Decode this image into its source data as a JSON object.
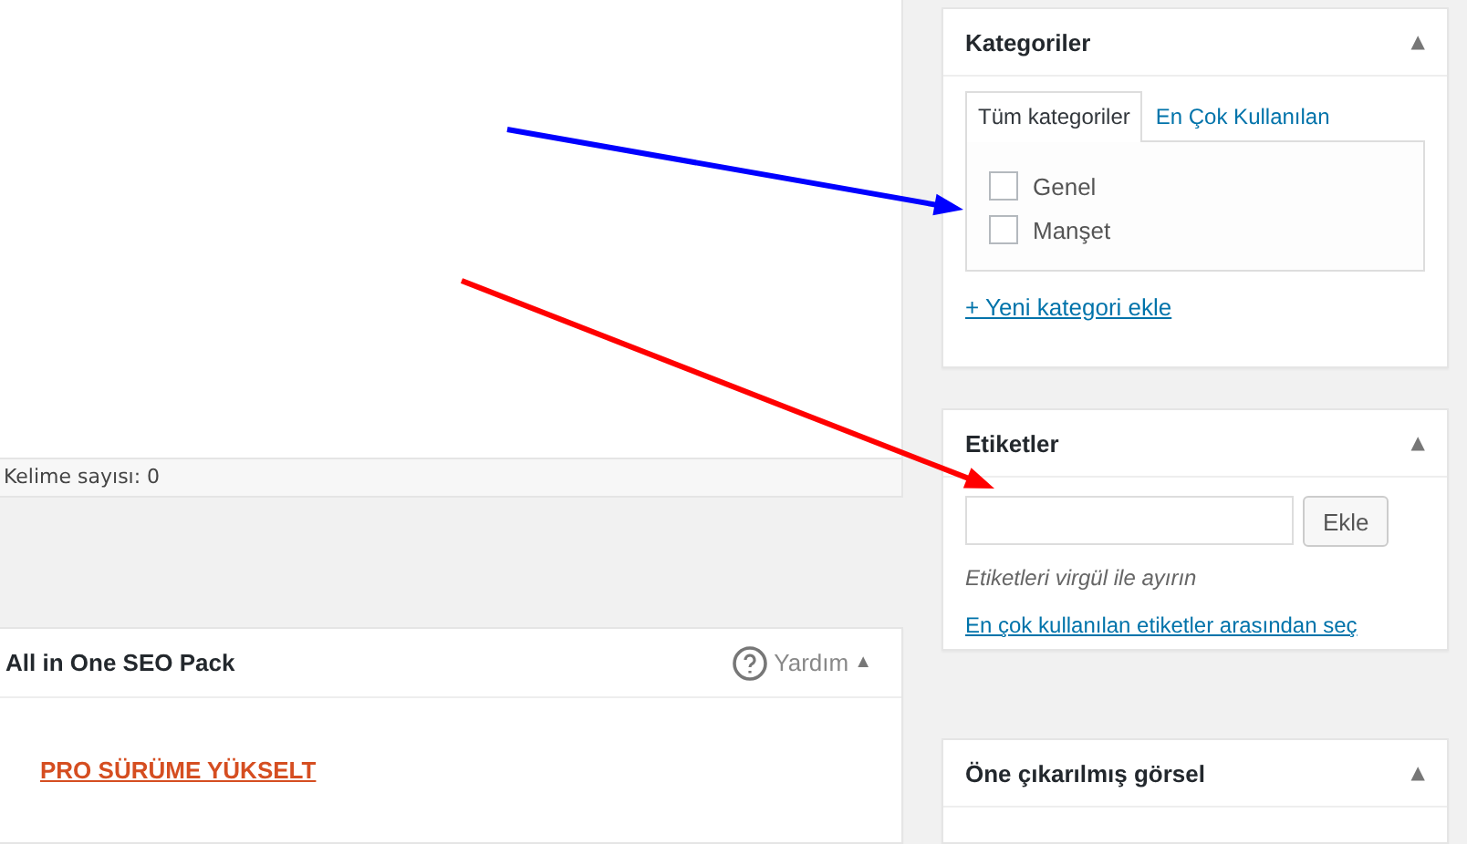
{
  "editor": {
    "word_count": "Kelime sayısı: 0"
  },
  "seo_box": {
    "title": "All in One SEO Pack",
    "help": "Yardım",
    "toggle": "▲",
    "upgrade_link": "PRO SÜRÜME YÜKSELT"
  },
  "categories_box": {
    "title": "Kategoriler",
    "toggle": "▲",
    "tabs": [
      {
        "label": "Tüm kategoriler",
        "selected": true
      },
      {
        "label": "En Çok Kullanılan",
        "selected": false
      }
    ],
    "items": [
      {
        "label": "Genel",
        "checked": false
      },
      {
        "label": "Manşet",
        "checked": false
      }
    ],
    "add_link": "+ Yeni kategori ekle"
  },
  "tags_box": {
    "title": "Etiketler",
    "toggle": "▲",
    "button": "Ekle",
    "hint": "Etiketleri virgül ile ayırın",
    "choose_link": "En çok kullanılan etiketler arasından seç"
  },
  "featured_box": {
    "title": "Öne çıkarılmış görsel",
    "toggle": "▲"
  },
  "annotations": [
    {
      "color": "#0000ff"
    },
    {
      "color": "#ff0000"
    }
  ]
}
